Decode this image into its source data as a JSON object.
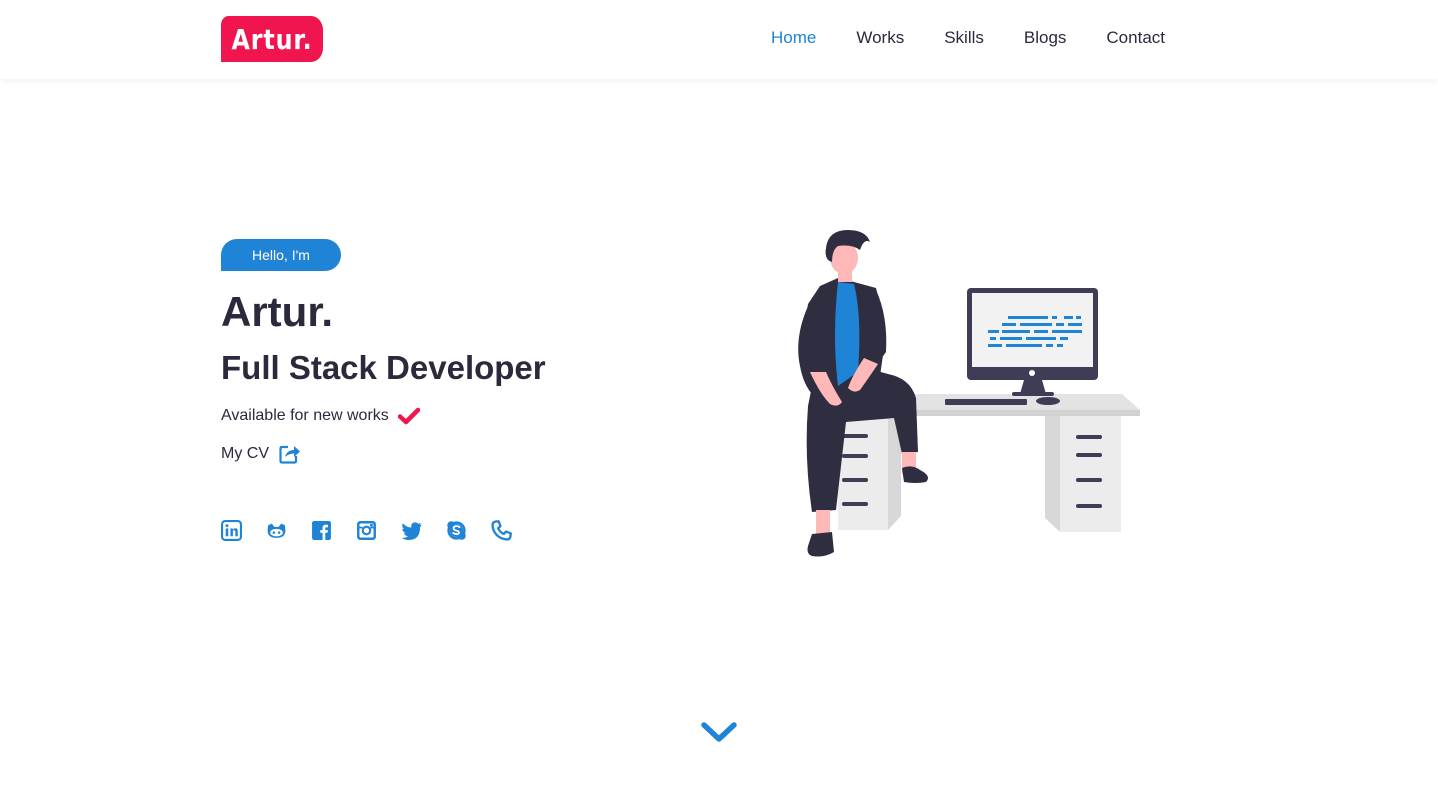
{
  "brand": {
    "logo": "Artur.",
    "accent": "#f0154f",
    "primary": "#1f83d6",
    "text": "#2b2a3d"
  },
  "nav": {
    "items": [
      {
        "label": "Home",
        "active": true
      },
      {
        "label": "Works",
        "active": false
      },
      {
        "label": "Skills",
        "active": false
      },
      {
        "label": "Blogs",
        "active": false
      },
      {
        "label": "Contact",
        "active": false
      }
    ]
  },
  "hero": {
    "badge": "Hello, I'm",
    "name": "Artur.",
    "role": "Full Stack Developer",
    "availability": "Available for new works",
    "cv_label": "My CV"
  },
  "socials": [
    {
      "icon": "linkedin-icon"
    },
    {
      "icon": "github-icon"
    },
    {
      "icon": "facebook-icon"
    },
    {
      "icon": "instagram-icon"
    },
    {
      "icon": "twitter-icon"
    },
    {
      "icon": "skype-icon"
    },
    {
      "icon": "phone-icon"
    }
  ],
  "scroll_icon": "chevron-down-icon"
}
